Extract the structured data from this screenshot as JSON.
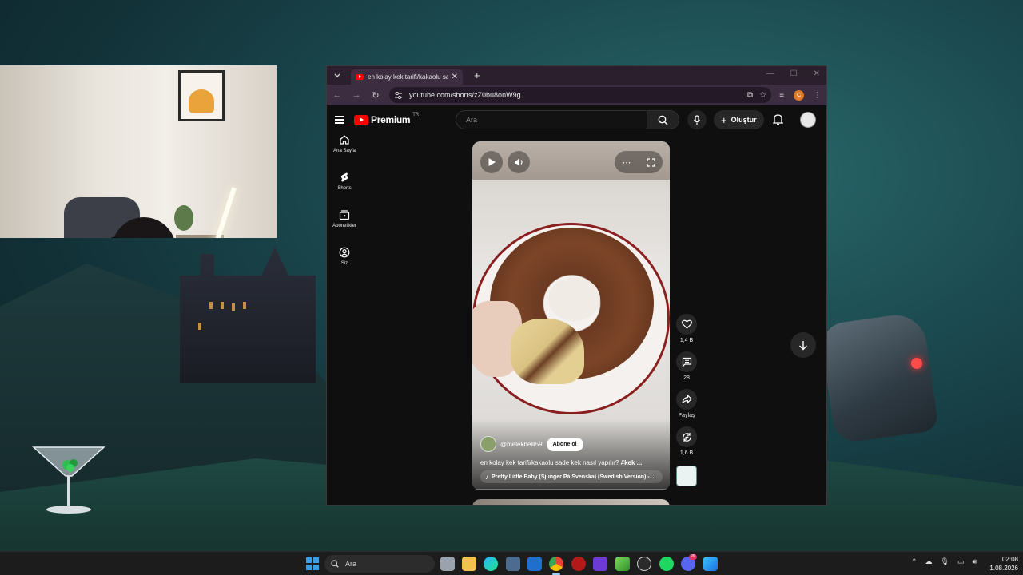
{
  "browser": {
    "tab_title": "en kolay kek tarifi/kakaolu sade",
    "url": "youtube.com/shorts/zZ0bu8onW9g",
    "profile_initial": "C"
  },
  "youtube": {
    "logo_text": "Premium",
    "region": "TR",
    "search_placeholder": "Ara",
    "create_label": "Oluştur",
    "nav": [
      {
        "label": "Ana Sayfa"
      },
      {
        "label": "Shorts"
      },
      {
        "label": "Abonelikler"
      },
      {
        "label": "Siz"
      }
    ]
  },
  "short": {
    "channel": "@melekbelli59",
    "subscribe_label": "Abone ol",
    "title": "en kolay kek tarifi/kakaolu sade kek nasıl yapılır?",
    "title_tag": "#kek ...",
    "music": "Pretty Little Baby (Sjunger På Svenska) (Swedish Version) -...",
    "likes": "1,4 B",
    "comments": "28",
    "share_label": "Paylaş",
    "remix": "1,6 B"
  },
  "taskbar": {
    "search_placeholder": "Ara",
    "time": "02:08",
    "date": "1.08.2026",
    "chat_badge": "99"
  },
  "colors": {
    "youtube_red": "#ff0000",
    "browser_frame": "#3d2d40",
    "windows_blue": "#3a9de8"
  }
}
